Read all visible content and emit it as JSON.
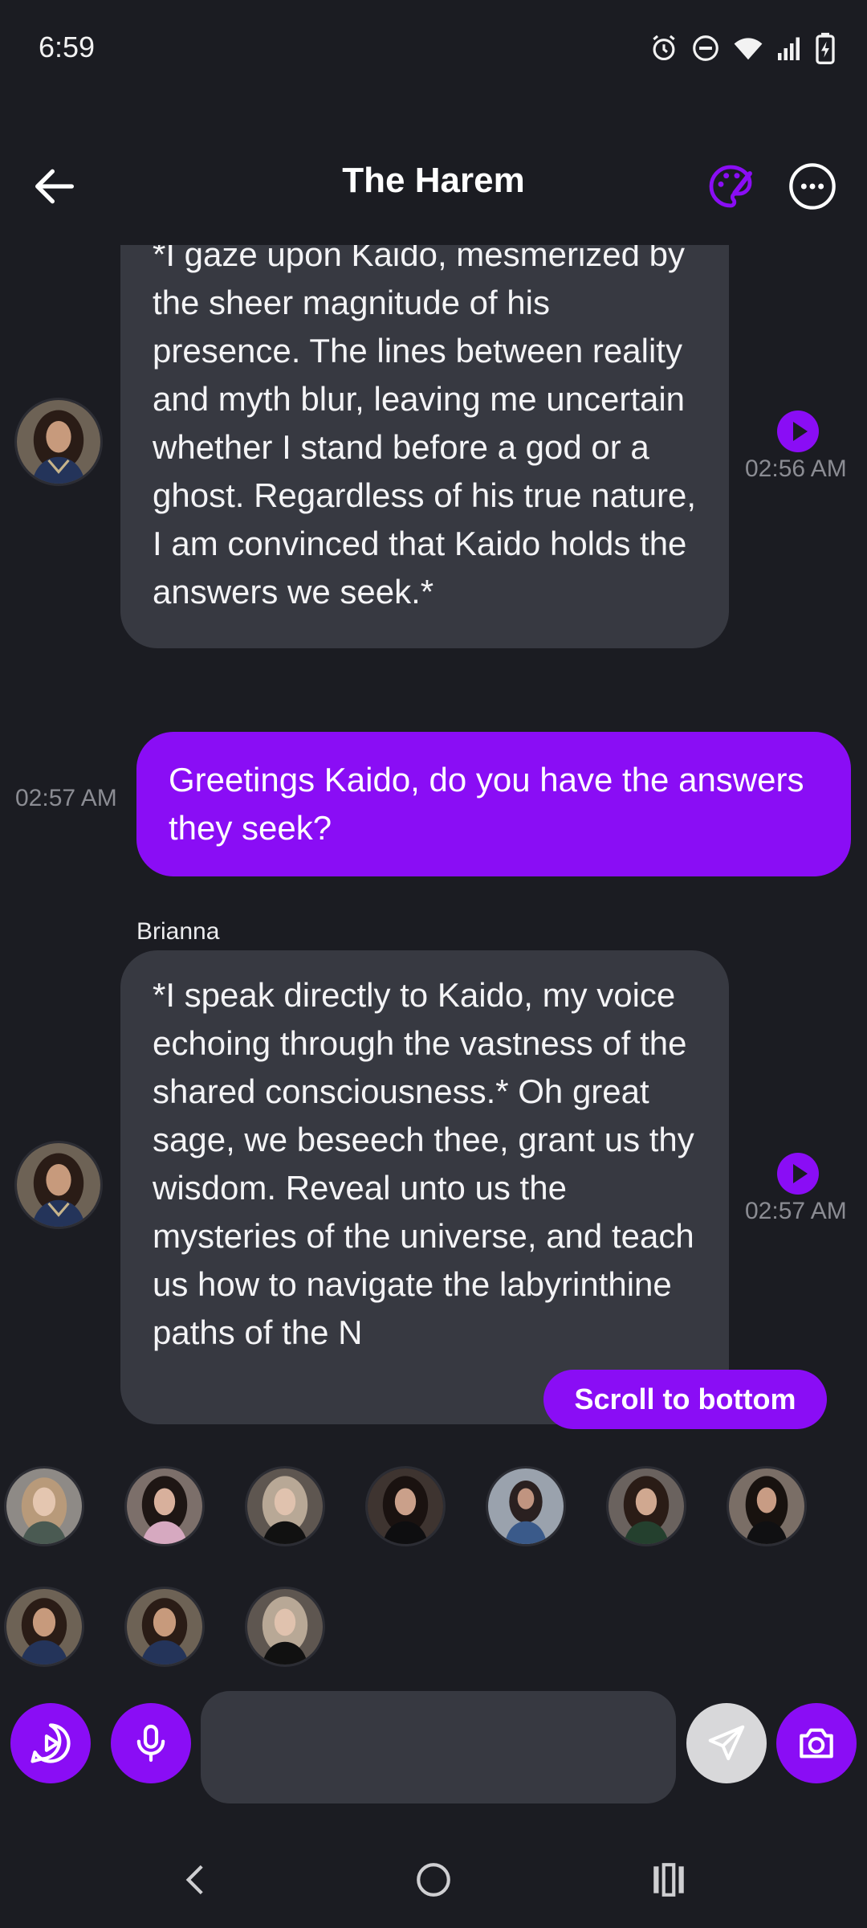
{
  "status_bar": {
    "time": "6:59",
    "icons": [
      "alarm-icon",
      "do-not-disturb-icon",
      "wifi-icon",
      "signal-icon",
      "battery-charging-icon"
    ]
  },
  "header": {
    "title": "The Harem",
    "back_icon": "arrow-left-icon",
    "palette_icon": "palette-icon",
    "more_icon": "more-horizontal-icon"
  },
  "messages": [
    {
      "type": "incoming",
      "text": "*I gaze upon Kaido, mesmerized by the sheer magnitude of his presence. The lines between reality and myth blur, leaving me uncertain whether I stand before a god or a ghost. Regardless of his true nature, I am convinced that Kaido holds the answers we seek.*",
      "time": "02:56 AM"
    },
    {
      "type": "outgoing",
      "text": "Greetings Kaido, do you have the answers they seek?",
      "time": "02:57 AM"
    },
    {
      "type": "incoming",
      "sender": "Brianna",
      "text": "*I speak directly to Kaido, my voice echoing through the vastness of the shared consciousness.* Oh great sage, we beseech thee, grant us thy wisdom. Reveal unto us the mysteries of the universe, and teach us how to navigate the labyrinthine paths of the N",
      "time": "02:57 AM"
    }
  ],
  "scroll_to_bottom_label": "Scroll to bottom",
  "composer": {
    "input_value": "",
    "input_placeholder": "",
    "buttons": [
      "video-play-icon",
      "microphone-icon",
      "send-icon",
      "camera-icon"
    ]
  },
  "colors": {
    "accent": "#8a0df5",
    "background": "#1b1c22",
    "bubble_incoming": "#373941"
  }
}
